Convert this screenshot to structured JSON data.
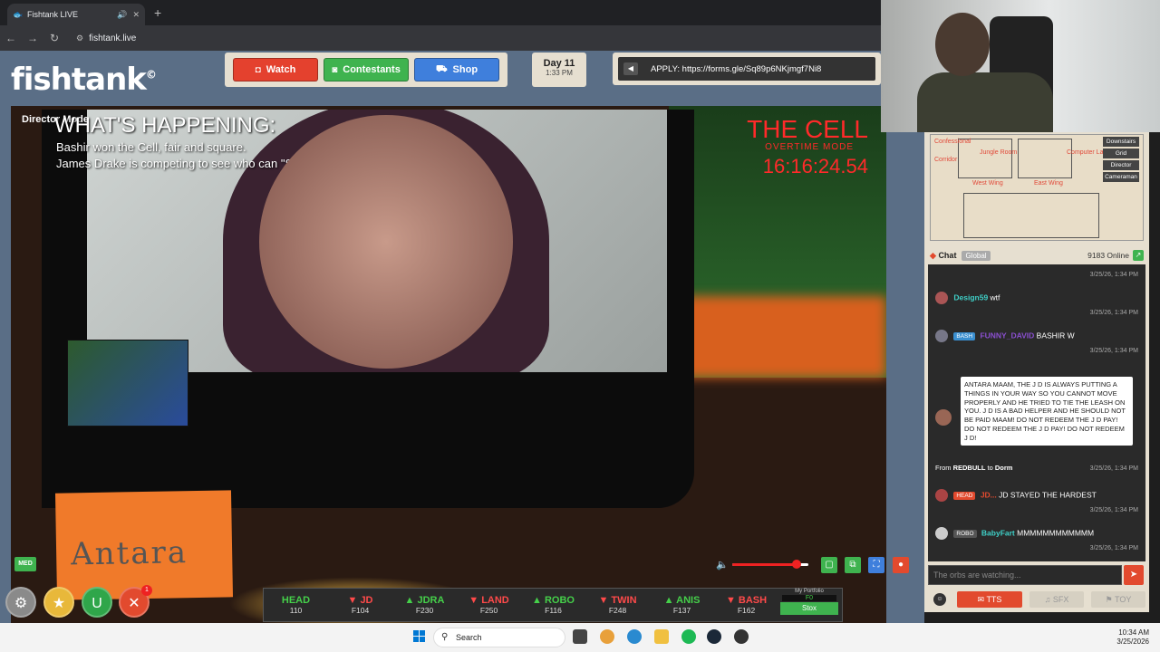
{
  "browser": {
    "tab_title": "Fishtank LIVE",
    "url": "fishtank.live"
  },
  "header": {
    "logo": "fishtank",
    "nav": [
      "Watch",
      "Contestants",
      "Shop"
    ],
    "day": "Day 11",
    "time": "1:33 PM",
    "apply": "APPLY: https://forms.gle/Sq89p6NKjmgf7Ni8"
  },
  "video": {
    "director_label": "Director Mode",
    "whats_happening": "WHAT'S HAPPENING:",
    "line1": "Bashir won the Cell, fair and square.",
    "line2": "James Drake is competing to see who can \"Stay The Hardest\"",
    "cell_title": "THE CELL",
    "cell_mode": "OVERTIME MODE",
    "cell_timer": "16:16:24.54",
    "nameplate": "Antara",
    "med_badge": "MED",
    "volume": 0.85
  },
  "stox": {
    "items": [
      {
        "name": "HEAD",
        "price": "110",
        "dir": ""
      },
      {
        "name": "JD",
        "price": "F104",
        "dir": "down"
      },
      {
        "name": "JDRA",
        "price": "F230",
        "dir": "up"
      },
      {
        "name": "LAND",
        "price": "F250",
        "dir": "down"
      },
      {
        "name": "ROBO",
        "price": "F116",
        "dir": "up"
      },
      {
        "name": "TWIN",
        "price": "F248",
        "dir": "down"
      },
      {
        "name": "ANIS",
        "price": "F137",
        "dir": "up"
      },
      {
        "name": "BASH",
        "price": "F162",
        "dir": "down"
      }
    ],
    "portfolio_label": "My Portfolio",
    "portfolio_value": "F0",
    "stox_button": "Stox"
  },
  "bottom_badge": "1",
  "map": {
    "rooms": [
      "Confessional",
      "Jungle Room",
      "Computer Lab",
      "Corridor",
      "West Wing",
      "East Wing"
    ],
    "menu": [
      "Downstairs",
      "Grid",
      "Director",
      "Cameraman"
    ]
  },
  "chat": {
    "title": "Chat",
    "scope": "Global",
    "online": "9183 Online",
    "messages": [
      {
        "ts": "3/25/26, 1:34 PM"
      },
      {
        "user": "Design59",
        "text": "wtf",
        "ts": "3/25/26, 1:34 PM"
      },
      {
        "tag": "BASH",
        "user": "FUNNY_DAVID",
        "text": "BASHIR W",
        "ts": "3/25/26, 1:34 PM"
      },
      {
        "tts": "ANTARA MAAM, THE J D IS ALWAYS PUTTING A THINGS IN YOUR WAY SO YOU CANNOT MOVE PROPERLY AND HE TRIED TO TIE THE LEASH ON YOU. J D IS A BAD HELPER AND HE SHOULD NOT BE PAID MAAM! DO NOT REDEEM THE J D PAY! DO NOT REDEEM THE J D PAY! DO NOT REDEEM J D!",
        "from": "From",
        "from_user": "REDBULL",
        "to": "to",
        "to_room": "Dorm",
        "ts": "3/25/26, 1:34 PM"
      },
      {
        "tag": "HEAD",
        "user": "JD...",
        "text": "JD STAYED THE HARDEST",
        "ts": "3/25/26, 1:34 PM"
      },
      {
        "tag": "ROBO",
        "user": "BabyFart",
        "text": "MMMMMMMMMMMM",
        "ts": "3/25/26, 1:34 PM"
      }
    ],
    "input_placeholder": "The orbs are watching...",
    "footer": [
      "TTS",
      "SFX",
      "TOY"
    ]
  },
  "taskbar": {
    "search": "Search",
    "time": "10:34 AM",
    "date": "3/25/2026"
  }
}
